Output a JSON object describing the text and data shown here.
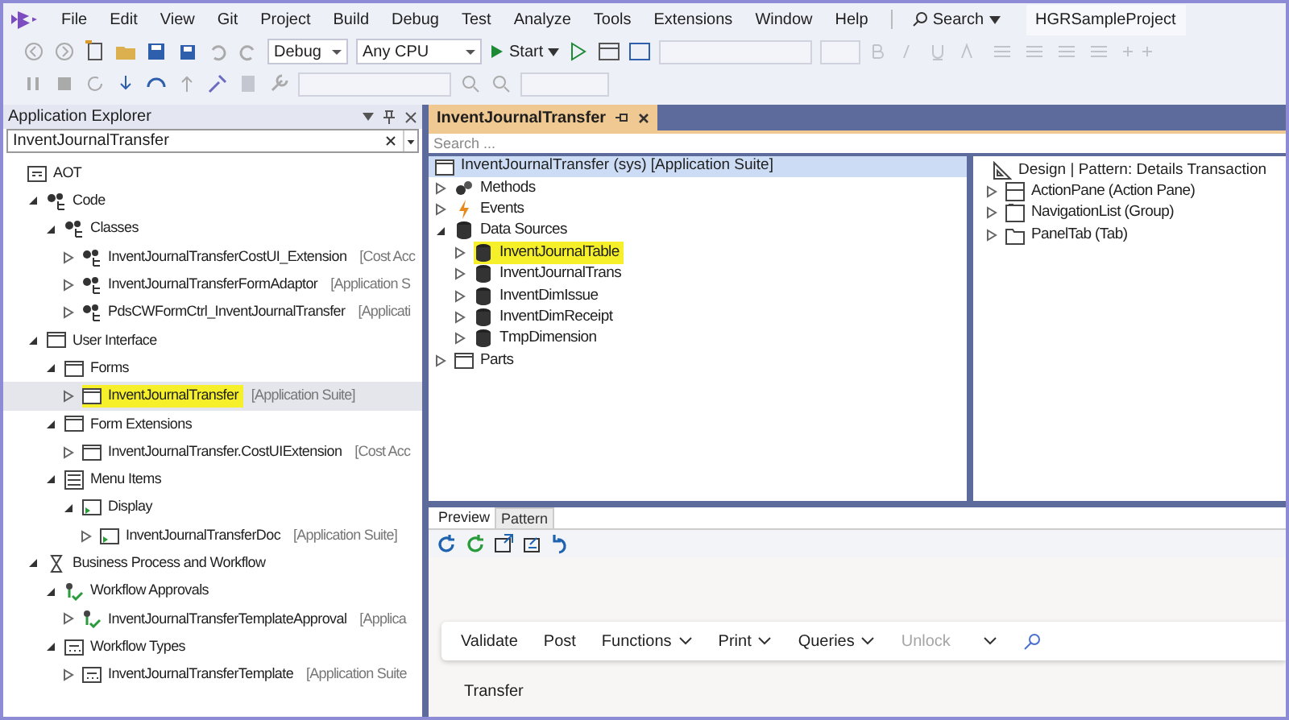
{
  "menu_bar": {
    "items": [
      "File",
      "Edit",
      "View",
      "Git",
      "Project",
      "Build",
      "Debug",
      "Test",
      "Analyze",
      "Tools",
      "Extensions",
      "Window",
      "Help"
    ],
    "search": "Search",
    "project": "HGRSampleProject"
  },
  "toolbar": {
    "configuration": "Debug",
    "platform": "Any CPU",
    "start": "Start"
  },
  "app_explorer": {
    "title": "Application Explorer",
    "search_value": "InventJournalTransfer",
    "tree": [
      {
        "label": "AOT",
        "kind": "aot",
        "children": [
          {
            "label": "Code",
            "kind": "code",
            "expanded": true,
            "children": [
              {
                "label": "Classes",
                "kind": "code",
                "expanded": true,
                "children": [
                  {
                    "label": "InventJournalTransferCostUI_Extension",
                    "suffix": "[Cost Acc",
                    "kind": "class",
                    "expanded": false
                  },
                  {
                    "label": "InventJournalTransferFormAdaptor",
                    "suffix": "[Application S",
                    "kind": "class",
                    "expanded": false
                  },
                  {
                    "label": "PdsCWFormCtrl_InventJournalTransfer",
                    "suffix": "[Applicati",
                    "kind": "class",
                    "expanded": false
                  }
                ]
              }
            ]
          },
          {
            "label": "User Interface",
            "kind": "form",
            "expanded": true,
            "children": [
              {
                "label": "Forms",
                "kind": "form",
                "expanded": true,
                "children": [
                  {
                    "label": "InventJournalTransfer",
                    "suffix": "[Application Suite]",
                    "kind": "form",
                    "expanded": false,
                    "selected": true,
                    "highlighted": true
                  }
                ]
              },
              {
                "label": "Form Extensions",
                "kind": "form",
                "expanded": true,
                "children": [
                  {
                    "label": "InventJournalTransfer.CostUIExtension",
                    "suffix": "[Cost Acc",
                    "kind": "form",
                    "expanded": false
                  }
                ]
              },
              {
                "label": "Menu Items",
                "kind": "menu",
                "expanded": true,
                "children": [
                  {
                    "label": "Display",
                    "kind": "display",
                    "expanded": true,
                    "children": [
                      {
                        "label": "InventJournalTransferDoc",
                        "suffix": "[Application Suite]",
                        "kind": "display",
                        "expanded": false
                      }
                    ]
                  }
                ]
              }
            ]
          },
          {
            "label": "Business Process and Workflow",
            "kind": "workflow",
            "expanded": true,
            "children": [
              {
                "label": "Workflow Approvals",
                "kind": "approval",
                "expanded": true,
                "children": [
                  {
                    "label": "InventJournalTransferTemplateApproval",
                    "suffix": "[Applica",
                    "kind": "approval",
                    "expanded": false
                  }
                ]
              },
              {
                "label": "Workflow Types",
                "kind": "wftype",
                "expanded": true,
                "children": [
                  {
                    "label": "InventJournalTransferTemplate",
                    "suffix": "[Application Suite",
                    "kind": "wftype",
                    "expanded": false
                  }
                ]
              }
            ]
          }
        ]
      }
    ]
  },
  "designer": {
    "tab": "InventJournalTransfer",
    "search_placeholder": "Search ...",
    "root": {
      "label": "InventJournalTransfer (sys) [Application Suite]",
      "kind": "form",
      "selected": true
    },
    "tree": [
      {
        "label": "Methods",
        "kind": "methods",
        "expanded": false
      },
      {
        "label": "Events",
        "kind": "events",
        "expanded": false
      },
      {
        "label": "Data Sources",
        "kind": "datasource",
        "expanded": true,
        "children": [
          {
            "label": "InventJournalTable",
            "kind": "datasource",
            "expanded": false,
            "highlighted": true
          },
          {
            "label": "InventJournalTrans",
            "kind": "datasource",
            "expanded": false
          },
          {
            "label": "InventDimIssue",
            "kind": "datasource",
            "expanded": false
          },
          {
            "label": "InventDimReceipt",
            "kind": "datasource",
            "expanded": false
          },
          {
            "label": "TmpDimension",
            "kind": "datasource",
            "expanded": false
          }
        ]
      },
      {
        "label": "Parts",
        "kind": "form",
        "expanded": false
      }
    ],
    "design": {
      "label": "Design | Pattern: Details Transaction",
      "kind": "design",
      "children": [
        {
          "label": "ActionPane (Action Pane)",
          "kind": "actionpane",
          "expanded": false
        },
        {
          "label": "NavigationList (Group)",
          "kind": "group",
          "expanded": false
        },
        {
          "label": "PanelTab (Tab)",
          "kind": "tab",
          "expanded": false
        }
      ]
    },
    "preview": {
      "tabs": [
        {
          "label": "Preview",
          "selected": true
        },
        {
          "label": "Pattern",
          "selected": false
        }
      ],
      "actions": [
        {
          "label": "Validate",
          "kind": "button",
          "disabled": false
        },
        {
          "label": "Post",
          "kind": "button",
          "disabled": false
        },
        {
          "label": "Functions",
          "kind": "menu",
          "disabled": false
        },
        {
          "label": "Print",
          "kind": "menu",
          "disabled": false
        },
        {
          "label": "Queries",
          "kind": "menu",
          "disabled": false
        },
        {
          "label": "Unlock",
          "kind": "button",
          "disabled": true
        },
        {
          "kind": "overflow",
          "disabled": false
        }
      ],
      "caption": "Transfer"
    }
  }
}
